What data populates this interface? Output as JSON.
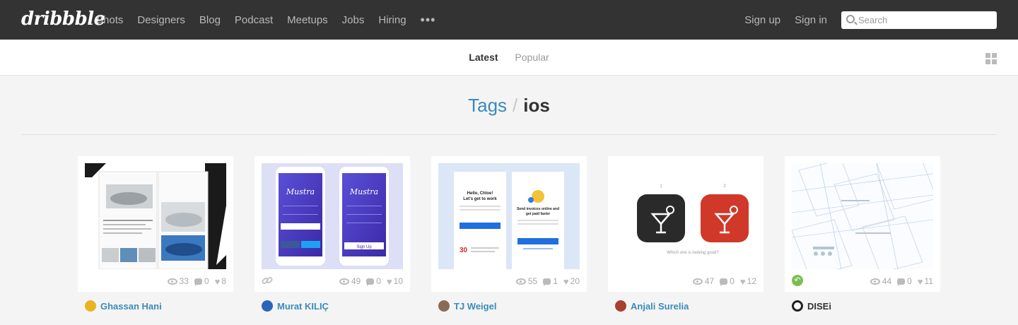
{
  "nav": {
    "logo": "dribbble",
    "links": [
      "Shots",
      "Designers",
      "Blog",
      "Podcast",
      "Meetups",
      "Jobs",
      "Hiring"
    ],
    "more": "•••",
    "sign_up": "Sign up",
    "sign_in": "Sign in",
    "search_placeholder": "Search"
  },
  "filters": {
    "latest": "Latest",
    "popular": "Popular",
    "active": "Latest"
  },
  "heading": {
    "tags": "Tags",
    "separator": "/",
    "tag": "ios"
  },
  "shots": [
    {
      "views": "33",
      "comments": "0",
      "likes": "8",
      "author": "Ghassan Hani",
      "avatar_color": "#e8b420"
    },
    {
      "views": "49",
      "comments": "0",
      "likes": "10",
      "author": "Murat KILIÇ",
      "avatar_color": "#2a66b8",
      "badge": "link-icon"
    },
    {
      "views": "55",
      "comments": "1",
      "likes": "20",
      "author": "TJ Weigel",
      "avatar_color": "#8a6b55"
    },
    {
      "views": "47",
      "comments": "0",
      "likes": "12",
      "author": "Anjali Surelia",
      "avatar_color": "#a84030"
    },
    {
      "views": "44",
      "comments": "0",
      "likes": "11",
      "author": "DISEi",
      "avatar_color": "#222222",
      "badge": "rebound-icon"
    }
  ],
  "colors": {
    "nav_bg": "#333333",
    "link_blue": "#3a8bbb",
    "page_bg": "#f4f4f4",
    "rebound_green": "#7bbf52"
  },
  "thumb_text": {
    "shot3_heading_1": "Hello, Chloe!",
    "shot3_heading_2": "Let's get to work",
    "shot3_heading_3": "Send invoices online and",
    "shot3_heading_4": "get paid faster",
    "shot3_number": "30",
    "shot4_label_1": "1",
    "shot4_label_2": "2",
    "shot4_caption": "Which one is looking good?",
    "shot2_brand": "Mustra",
    "shot2_button": "Sign Up"
  }
}
